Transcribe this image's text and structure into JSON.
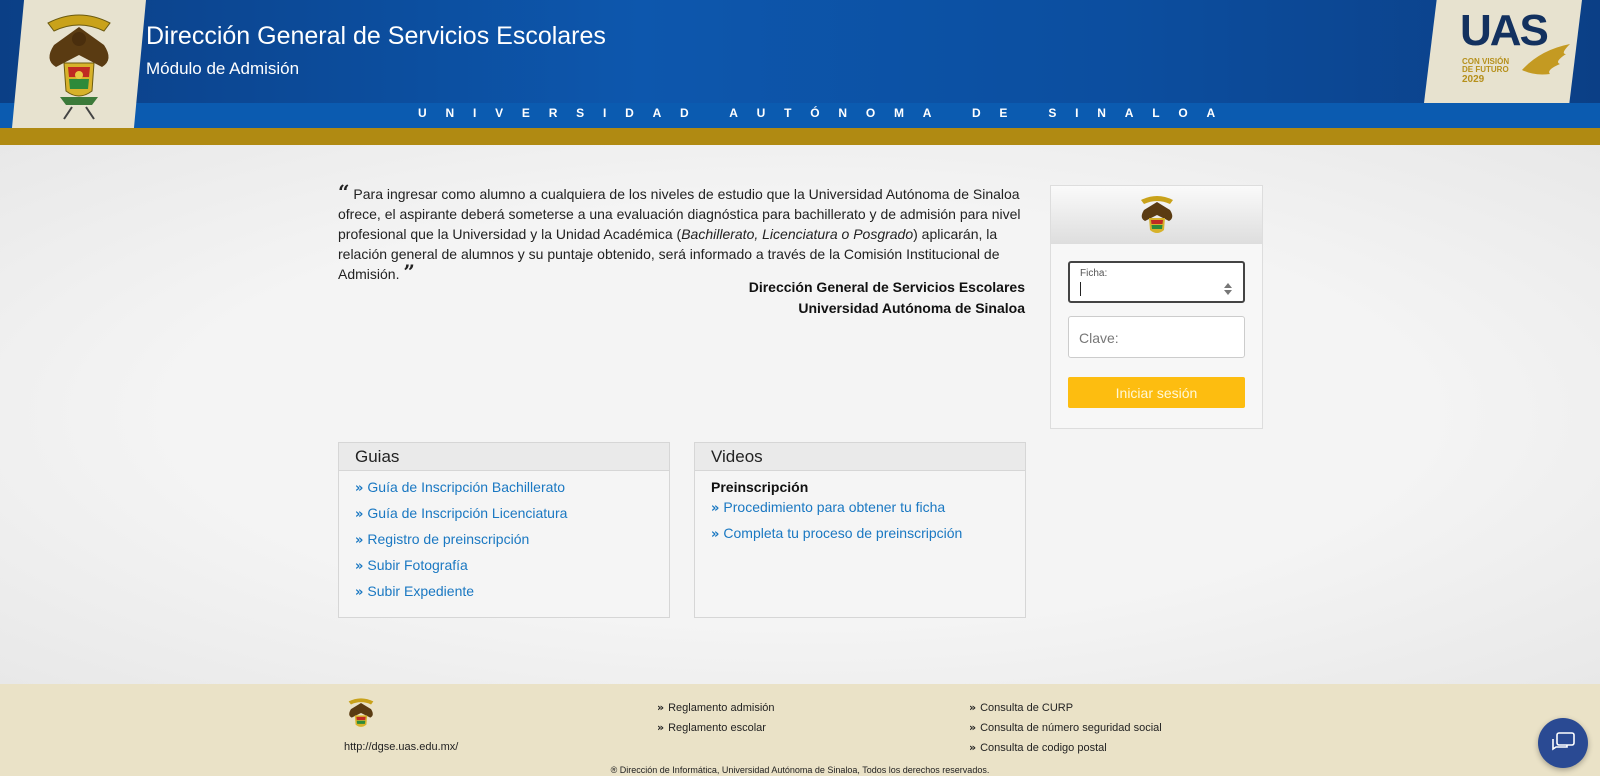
{
  "header": {
    "title": "Dirección General de Servicios Escolares",
    "subtitle": "Módulo de Admisión",
    "university_strip": "UNIVERSIDAD AUTÓNOMA DE SINALOA",
    "right_logo": {
      "text": "UAS",
      "tagline": "CON VISIÓN DE FUTURO",
      "year": "2029"
    }
  },
  "intro": {
    "text_before": "Para ingresar como alumno a cualquiera de los niveles de estudio que la Universidad Autónoma de Sinaloa ofrece, el aspirante deberá someterse a una evaluación diagnóstica para bachillerato y de admisión para nivel profesional que la Universidad y la Unidad Académica (",
    "text_italic": "Bachillerato, Licenciatura o Posgrado",
    "text_after": ") aplicarán, la relación general de alumnos y su puntaje obtenido, será informado a través de la Comisión Institucional de Admisión.",
    "signature_line1": "Dirección General de Servicios Escolares",
    "signature_line2": "Universidad Autónoma de Sinaloa"
  },
  "login": {
    "ficha_label": "Ficha:",
    "ficha_value": "",
    "clave_placeholder": "Clave:",
    "submit_label": "Iniciar sesión"
  },
  "guias": {
    "title": "Guias",
    "links": [
      "Guía de Inscripción Bachillerato",
      "Guía de Inscripción Licenciatura",
      "Registro de preinscripción",
      "Subir Fotografía",
      "Subir Expediente"
    ]
  },
  "videos": {
    "title": "Videos",
    "subtitle": "Preinscripción",
    "links": [
      "Procedimiento para obtener tu ficha",
      "Completa tu proceso de preinscripción"
    ]
  },
  "footer": {
    "url": "http://dgse.uas.edu.mx/",
    "col1": [
      "Reglamento admisión",
      "Reglamento escolar"
    ],
    "col2": [
      "Consulta de CURP",
      "Consulta de número seguridad social",
      "Consulta de codigo postal"
    ],
    "copyright": "® Dirección de Informática, Universidad Autónoma de Sinaloa, Todos los derechos reservados."
  },
  "colors": {
    "header_blue": "#0b4f9f",
    "gold": "#b08a12",
    "link_blue": "#1a78c2",
    "button_yellow": "#fdbd10",
    "footer_bg": "#eae2c7"
  }
}
